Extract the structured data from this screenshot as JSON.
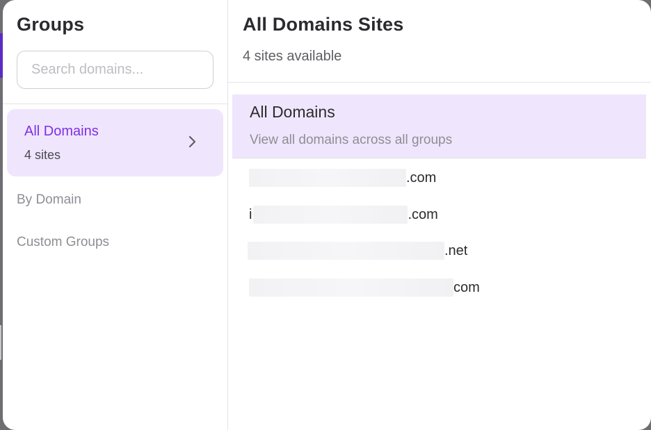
{
  "sidebar": {
    "title": "Groups",
    "search_placeholder": "Search domains...",
    "active_group": {
      "name": "All Domains",
      "count": "4 sites"
    },
    "groups": [
      {
        "label": "By Domain"
      },
      {
        "label": "Custom Groups"
      }
    ]
  },
  "main": {
    "title": "All Domains Sites",
    "subtitle": "4 sites available",
    "all_domains": {
      "title": "All Domains",
      "description": "View all domains across all groups"
    },
    "sites": [
      {
        "prefix": "",
        "suffix": ".com"
      },
      {
        "prefix": "i",
        "suffix": ".com"
      },
      {
        "prefix": "",
        "suffix": ".net"
      },
      {
        "prefix": "",
        "suffix": "com"
      }
    ]
  },
  "colors": {
    "accent": "#7f2fe6",
    "selection_bg": "#efe6fd",
    "backdrop": "#6e6e72"
  }
}
